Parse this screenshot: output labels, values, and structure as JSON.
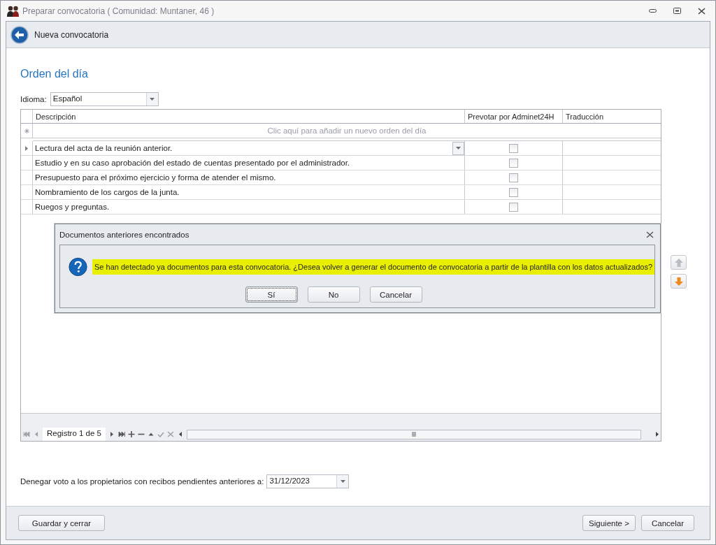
{
  "window": {
    "title": "Preparar convocatoria ( Comunidad: Muntaner, 46 )"
  },
  "header": {
    "title": "Nueva convocatoria"
  },
  "section_title": "Orden del día",
  "language": {
    "label": "Idioma:",
    "value": "Español"
  },
  "grid": {
    "columns": [
      "Descripción",
      "Prevotar por Adminet24H",
      "Traducción"
    ],
    "new_row_hint": "Clic aquí para añadir un nuevo orden del día",
    "rows": [
      {
        "description": "Lectura del acta de la reunión anterior.",
        "prevote": false,
        "selected": true
      },
      {
        "description": "Estudio y en su caso aprobación del estado de cuentas presentado por el administrador.",
        "prevote": false,
        "selected": false
      },
      {
        "description": "Presupuesto para el próximo ejercicio y forma de atender el mismo.",
        "prevote": false,
        "selected": false
      },
      {
        "description": "Nombramiento de los cargos de la junta.",
        "prevote": false,
        "selected": false
      },
      {
        "description": "Ruegos y preguntas.",
        "prevote": false,
        "selected": false
      }
    ]
  },
  "navigator": {
    "record": "Registro 1 de 5"
  },
  "move_buttons": [
    {
      "kind": "up",
      "disabled": true
    },
    {
      "kind": "down",
      "disabled": false
    }
  ],
  "dialog": {
    "title": "Documentos anteriores encontrados",
    "message": "Se han detectado ya documentos para esta convocatoria. ¿Desea volver a generar el documento de convocatoria a partir de la plantilla con los datos actualizados?",
    "buttons": [
      {
        "label": "Sí",
        "focused": true
      },
      {
        "label": "No",
        "focused": false
      },
      {
        "label": "Cancelar",
        "focused": false
      }
    ]
  },
  "deny_vote": {
    "label": "Denegar voto a los propietarios con recibos pendientes anteriores a:",
    "value": "31/12/2023"
  },
  "footer": {
    "left_buttons": [
      "Guardar y cerrar"
    ],
    "right_buttons": [
      "Siguiente >",
      "Cancelar"
    ]
  }
}
